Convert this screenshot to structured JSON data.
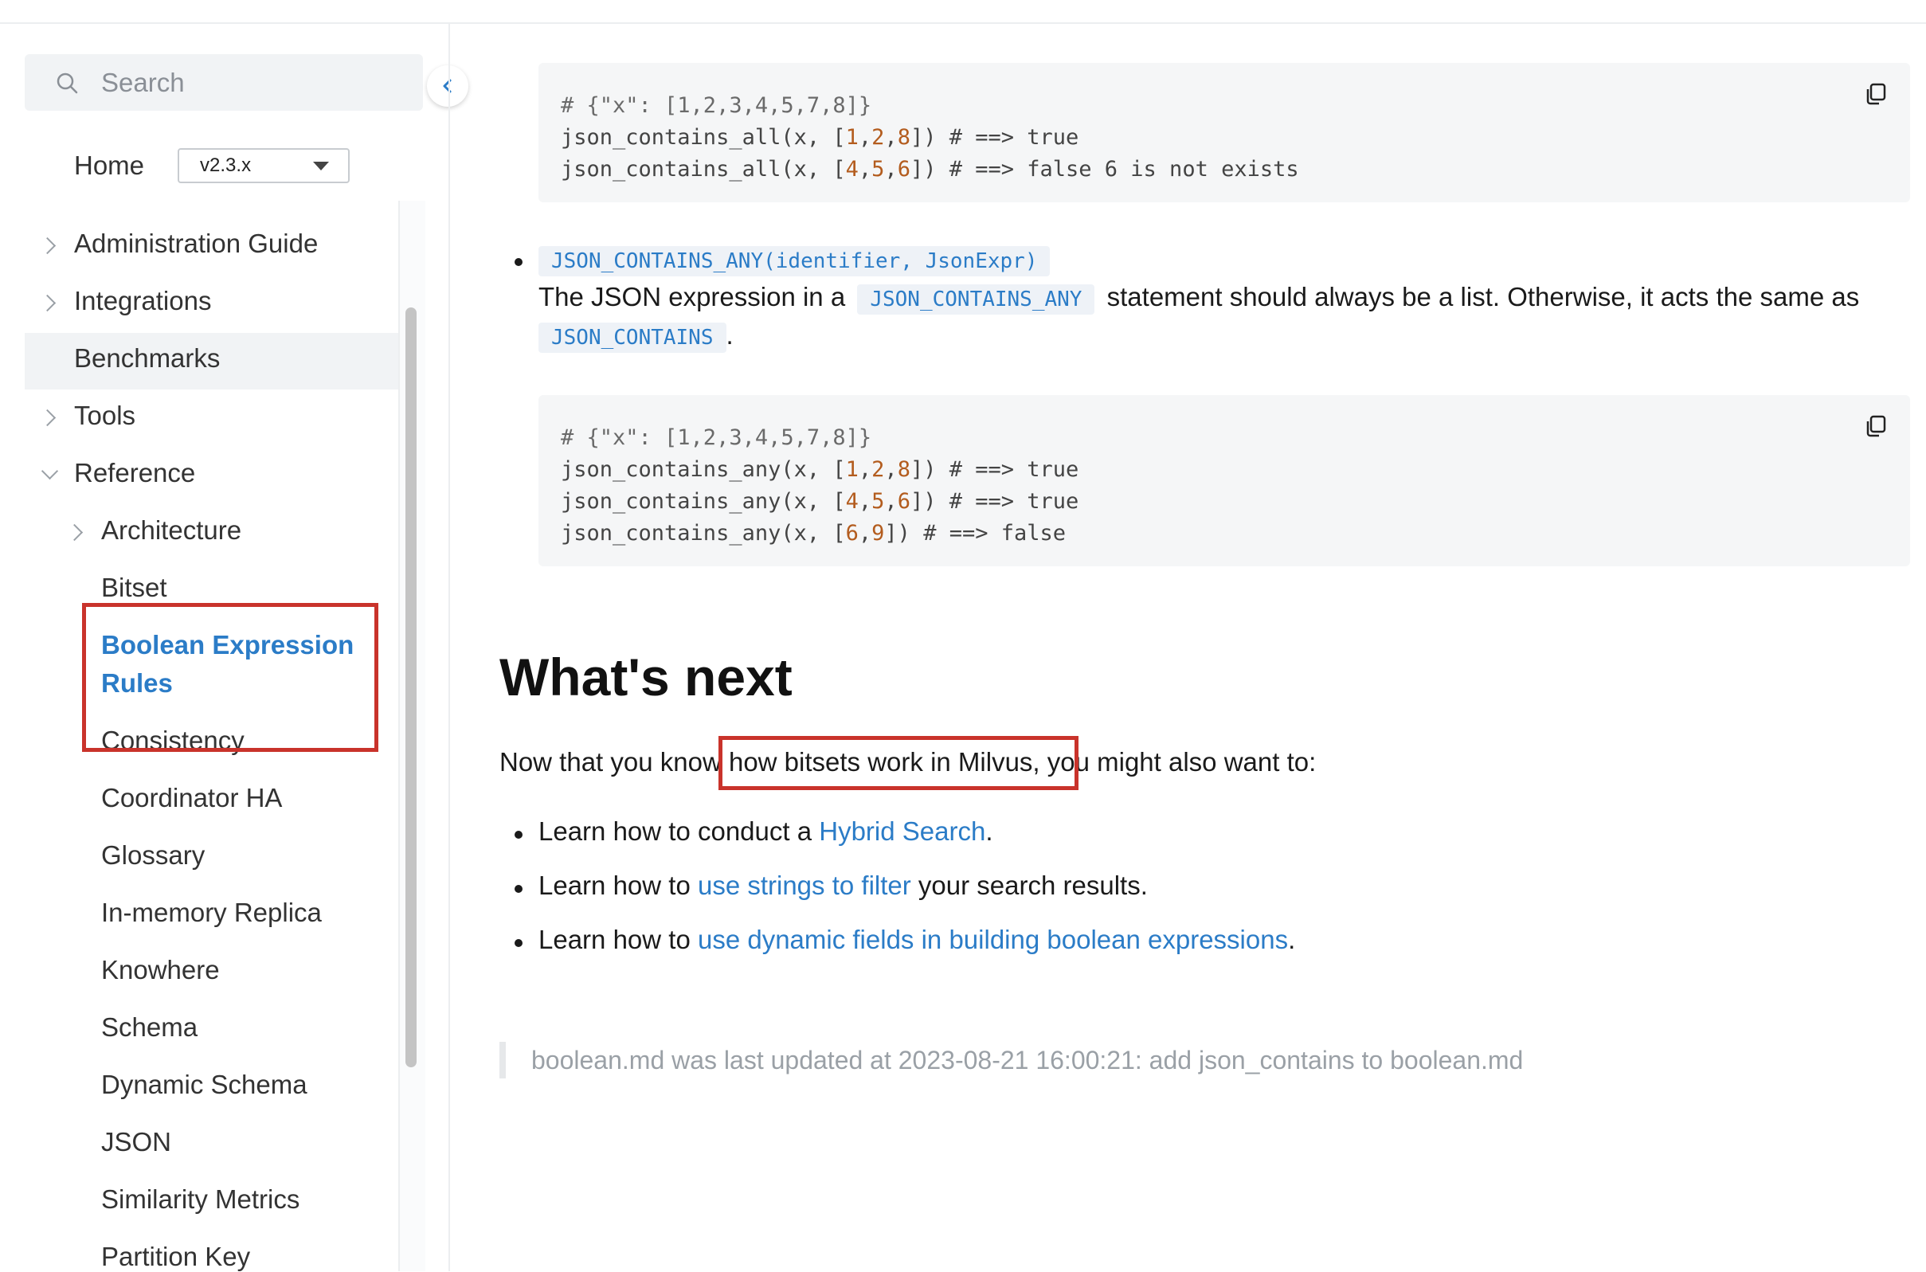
{
  "search": {
    "placeholder": "Search"
  },
  "home": {
    "label": "Home",
    "version": "v2.3.x"
  },
  "sidebar": {
    "items": [
      {
        "label": "Administration Guide"
      },
      {
        "label": "Integrations"
      },
      {
        "label": "Benchmarks"
      },
      {
        "label": "Tools"
      },
      {
        "label": "Reference"
      }
    ],
    "reference_children": [
      {
        "label": "Architecture"
      },
      {
        "label": "Bitset"
      },
      {
        "label": "Boolean Expression"
      },
      {
        "label": "Rules"
      },
      {
        "label": "Consistency"
      },
      {
        "label": "Coordinator HA"
      },
      {
        "label": "Glossary"
      },
      {
        "label": "In-memory Replica"
      },
      {
        "label": "Knowhere"
      },
      {
        "label": "Schema"
      },
      {
        "label": "Dynamic Schema"
      },
      {
        "label": "JSON"
      },
      {
        "label": "Similarity Metrics"
      },
      {
        "label": "Partition Key"
      }
    ]
  },
  "main": {
    "code1": {
      "comment": "# {\"x\": [1,2,3,4,5,7,8]}",
      "l2_pre": "json_contains_all(x, [",
      "l2_n1": "1",
      "l2_n2": "2",
      "l2_n3": "8",
      "l2_post": "]) # ==> true",
      "l3_pre": "json_contains_all(x, [",
      "l3_n1": "4",
      "l3_n2": "5",
      "l3_n3": "6",
      "l3_post": "]) # ==> false 6 is not exists"
    },
    "bullet_code": "JSON_CONTAINS_ANY(identifier, JsonExpr)",
    "desc_part1": "The JSON expression in a",
    "desc_code": "JSON_CONTAINS_ANY",
    "desc_part2": "statement should always be a list. Otherwise, it acts the same as",
    "desc_code2": "JSON_CONTAINS",
    "desc_end": ".",
    "code2": {
      "comment": "# {\"x\": [1,2,3,4,5,7,8]}",
      "l2_pre": "json_contains_any(x, [",
      "l2_n1": "1",
      "l2_n2": "2",
      "l2_n3": "8",
      "l2_post": "]) # ==> true",
      "l3_pre": "json_contains_any(x, [",
      "l3_n1": "4",
      "l3_n2": "5",
      "l3_n3": "6",
      "l3_post": "]) # ==> true",
      "l4_pre": "json_contains_any(x, [",
      "l4_n1": "6",
      "l4_n2": "9",
      "l4_post": "]) # ==> false"
    },
    "heading": "What's next",
    "intro": "Now that you know how bitsets work in Milvus, you might also want to:",
    "next_items": [
      {
        "pre": "Learn how to conduct a ",
        "link": "Hybrid Search",
        "post": "."
      },
      {
        "pre": "Learn how to ",
        "link": "use strings to filter",
        "post": " your search results."
      },
      {
        "pre": "Learn how to ",
        "link": "use dynamic fields in building boolean expressions",
        "post": "."
      }
    ],
    "footer": "boolean.md was last updated at 2023-08-21 16:00:21: add json_contains to boolean.md"
  },
  "colors": {
    "accent": "#2b7cc7",
    "highlight": "#c9332b"
  }
}
